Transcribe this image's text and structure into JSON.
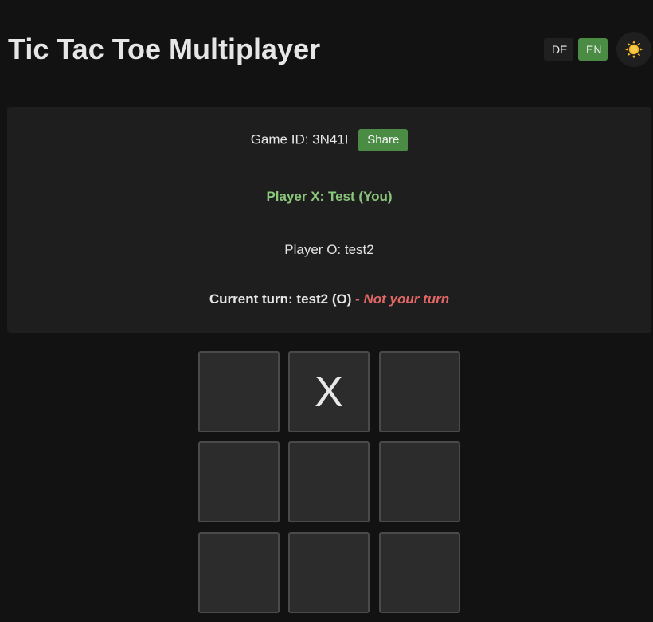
{
  "header": {
    "title": "Tic Tac Toe Multiplayer",
    "lang_de": "DE",
    "lang_en": "EN",
    "active_lang": "EN",
    "theme_icon": "sun-icon"
  },
  "game": {
    "game_id_text": "Game ID: 3N41I",
    "share_label": "Share",
    "player_x": "Player X: Test (You)",
    "player_o": "Player O: test2",
    "current_turn": "Current turn: test2 (O)",
    "turn_warning": "- Not your turn"
  },
  "board": {
    "cells": [
      "",
      "X",
      "",
      "",
      "",
      "",
      "",
      "",
      ""
    ]
  },
  "colors": {
    "accent_green": "#4a8c43",
    "player_x_green": "#8bc77a",
    "warning_red": "#e06666",
    "background": "#121212",
    "panel": "#1e1e1e",
    "cell": "#2c2c2c"
  }
}
